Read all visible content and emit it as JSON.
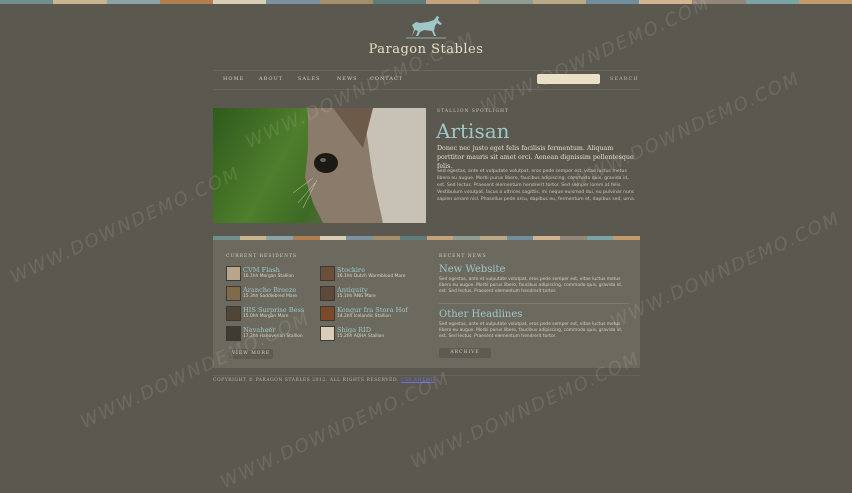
{
  "colors": {
    "background": "#5b5850",
    "accent": "#9fc7c8",
    "panel": "#6c695f",
    "stripe": [
      "#6f8f8a",
      "#c9b48d",
      "#8aa3a8",
      "#b37e50",
      "#d8cfb4",
      "#7d92a0",
      "#a3906a",
      "#5f7c78",
      "#c5a27c",
      "#8d9d94",
      "#b9a986",
      "#6f8fa0",
      "#d1b58f",
      "#93877a",
      "#7aa4a6",
      "#c29a6b"
    ]
  },
  "logo": {
    "icon": "horse-icon",
    "brand": "Paragon Stables"
  },
  "nav": {
    "items": [
      "HOME",
      "ABOUT",
      "SALES",
      "NEWS",
      "CONTACT"
    ]
  },
  "search": {
    "placeholder": "",
    "button_label": "SEARCH"
  },
  "spotlight": {
    "label": "STALLION SPOTLIGHT",
    "title": "Artisan",
    "lead": "Donec nec justo eget felis facilisis fermentum. Aliquam porttitor mauris sit amet orci. Aenean dignissim pellentesque felis.",
    "body": "Sed egestas, ante et vulputate volutpat, eros pede semper est, vitae luctus metus libero eu augue. Morbi purus libero, faucibus adipiscing, commodo quis, gravida id, est. Sed lectus. Praesent elementum hendrerit tortor. Sed semper lorem at felis. Vestibulum volutpat, lacus a ultrices sagittis, mi neque euismod dui, eu pulvinar nunc sapien ornare nisl. Phasellus pede arcu, dapibus eu, fermentum et, dapibus sed, urna."
  },
  "residents": {
    "label": "CURRENT RESIDENTS",
    "items": [
      {
        "name": "CVM Flash",
        "desc": "16.1hh Morgan Stallion"
      },
      {
        "name": "Arancho Breeze",
        "desc": "15.3hh Saddlebred Mare"
      },
      {
        "name": "HIS Surprise Bess",
        "desc": "15.0hh Morgan Mare"
      },
      {
        "name": "Navaheer",
        "desc": "17.2hh Hanoverian Stallion"
      },
      {
        "name": "Stockire",
        "desc": "16.1hh Dutch Warmblood Mare"
      },
      {
        "name": "Antiquity",
        "desc": "15.1hh ANG Mare"
      },
      {
        "name": "Kongur fra Stora Hof",
        "desc": "14.2hh Icelandic Stallion"
      },
      {
        "name": "Shiga RID",
        "desc": "15.2hh AQHA Stallion"
      }
    ],
    "button_label": "VIEW MORE"
  },
  "news": {
    "label": "RECENT NEWS",
    "items": [
      {
        "title": "New Website",
        "body": "Sed egestas, ante et vulputate volutpat, eros pede semper est, vitae luctus metus libero eu augue. Morbi purus libero, faucibus adipiscing, commodo quis, gravida id, est. Sed lectus. Praesent elementum hendrerit tortor."
      },
      {
        "title": "Other Headlines",
        "body": "Sed egestas, ante et vulputate volutpat, eros pede semper est, vitae luctus metus libero eu augue. Morbi purus libero, faucibus adipiscing, commodo quis, gravida id, est. Sed lectus. Praesent elementum hendrerit tortor."
      }
    ],
    "button_label": "ARCHIVE"
  },
  "footer": {
    "text": "COPYRIGHT © PARAGON STABLES 2012. ALL RIGHTS RESERVED.",
    "link": "CSS XHTML"
  },
  "watermark": "WWW.DOWNDEMO.COM"
}
